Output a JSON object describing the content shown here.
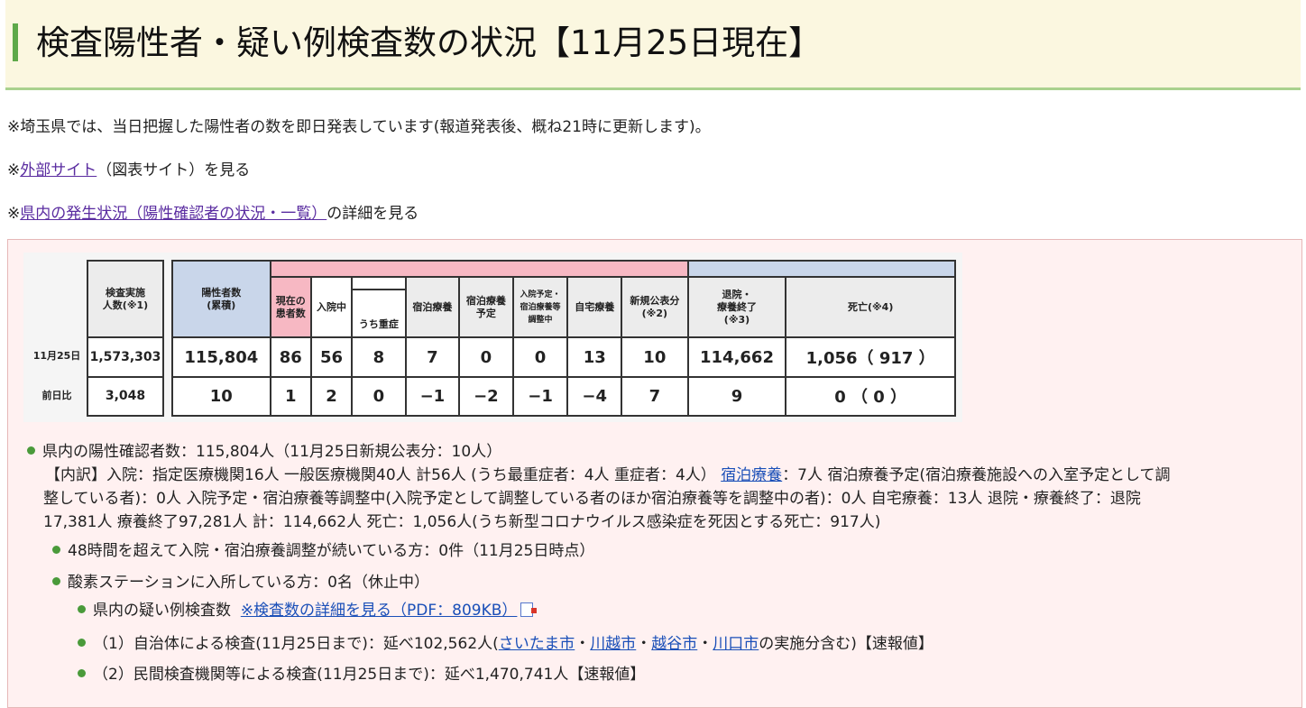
{
  "page": {
    "title": "検査陽性者・疑い例検査数の状況【11月25日現在】"
  },
  "notes": {
    "note1": "※埼玉県では、当日把握した陽性者の数を即日発表しています(報道発表後、概ね21時に更新します)。",
    "note2_prefix": "※",
    "note2_link": "外部サイト",
    "note2_suffix": "（図表サイト）を見る",
    "note3_prefix": "※",
    "note3_link": "県内の発生状況（陽性確認者の状況・一覧）",
    "note3_suffix": "の詳細を見る"
  },
  "table": {
    "headers": {
      "tested": "検査実施\n人数(※1)",
      "positive": "陽性者数\n(累積)",
      "current": "現在の\n患者数",
      "hospitalized": "入院中",
      "severe": "うち重症",
      "hotel": "宿泊療養",
      "hotel_planned": "宿泊療養\n予定",
      "adjusting": "入院予定・\n宿泊療養等\n調整中",
      "home": "自宅療養",
      "new": "新規公表分\n(※2)",
      "discharged": "退院・\n療養終了\n(※3)",
      "deaths": "死亡(※4)"
    },
    "rows": [
      {
        "label": "11月25日",
        "tested": "1,573,303",
        "positive": "115,804",
        "current": "86",
        "hospitalized": "56",
        "severe": "8",
        "hotel": "7",
        "hotel_planned": "0",
        "adjusting": "0",
        "home": "13",
        "new": "10",
        "discharged": "114,662",
        "deaths": "1,056（ 917 ）"
      },
      {
        "label": "前日比",
        "tested": "3,048",
        "positive": "10",
        "current": "1",
        "hospitalized": "2",
        "severe": "0",
        "hotel": "−1",
        "hotel_planned": "−2",
        "adjusting": "−1",
        "home": "−4",
        "new": "7",
        "discharged": "9",
        "deaths": "0 （ 0 ）"
      }
    ]
  },
  "details": {
    "summary": "県内の陽性確認者数：115,804人（11月25日新規公表分：10人）",
    "breakdown_1": "【内訳】入院：指定医療機関16人 一般医療機関40人 計56人 (うち最重症者：4人 重症者：4人）",
    "breakdown_link": "宿泊療養",
    "breakdown_2": "：7人 宿泊療養予定(宿泊療養施設への入室予定として調",
    "breakdown_3": "整している者)：0人 入院予定・宿泊療養等調整中(入院予定として調整している者のほか宿泊療養等を調整中の者)：0人 自宅療養：13人 退院・療養終了：退院",
    "breakdown_4": "17,381人 療養終了97,281人 計：114,662人 死亡：1,056人(うち新型コロナウイルス感染症を死因とする死亡：917人)",
    "over48": "48時間を超えて入院・宿泊療養調整が続いている方：0件（11月25日時点）",
    "oxygen": "酸素ステーションに入所している方：0名（休止中）",
    "suspect_label": "県内の疑い例検査数",
    "suspect_link": "※検査数の詳細を見る（PDF：809KB）",
    "local_prefix": "（1）自治体による検査(11月25日まで)：延べ102,562人(",
    "city1": "さいたま市",
    "sep": "・",
    "city2": "川越市",
    "city3": "越谷市",
    "city4": "川口市",
    "local_suffix": "の実施分含む)【速報値】",
    "private": "（2）民間検査機関等による検査(11月25日まで)：延べ1,470,741人【速報値】"
  },
  "colors": {
    "accent": "#5ea94a",
    "title_bg": "#fbf7e0",
    "panel_bg": "#fff1f1",
    "header_pink": "#f7b8c3",
    "header_gray": "#d4d4d4",
    "header_blue": "#c9d6ea"
  }
}
